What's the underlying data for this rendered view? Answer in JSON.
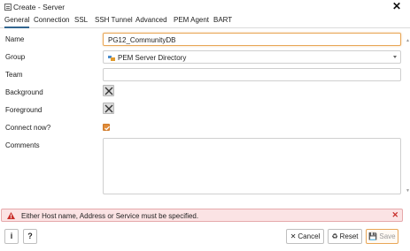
{
  "window": {
    "title": "Create - Server",
    "close_glyph": "✕"
  },
  "tabs": [
    "General",
    "Connection",
    "SSL",
    "SSH Tunnel",
    "Advanced",
    "PEM Agent",
    "BART"
  ],
  "form": {
    "name_label": "Name",
    "name_value": "PG12_CommunityDB",
    "group_label": "Group",
    "group_value": "PEM Server Directory",
    "team_label": "Team",
    "team_value": "",
    "background_label": "Background",
    "foreground_label": "Foreground",
    "connect_now_label": "Connect now?",
    "connect_now_checked": true,
    "comments_label": "Comments",
    "comments_value": ""
  },
  "error": {
    "message": "Either Host name, Address or Service must be specified.",
    "close_glyph": "✕"
  },
  "footer": {
    "info_label": "i",
    "help_label": "?",
    "cancel_icon": "✕",
    "cancel_label": "Cancel",
    "reset_icon": "♻",
    "reset_label": "Reset",
    "save_icon": "💾",
    "save_label": "Save"
  },
  "colors": {
    "accent": "#326690",
    "focus": "#e8a656",
    "checkbox": "#e08c3a",
    "error_bg": "#fbe3e4",
    "error_border": "#e6a9ab",
    "error_icon": "#c9302c"
  },
  "icons": {
    "title": "server-dialog-icon",
    "group": "server-group-icon",
    "color_reset": "x-cross-icon",
    "error": "warning-triangle-icon"
  }
}
